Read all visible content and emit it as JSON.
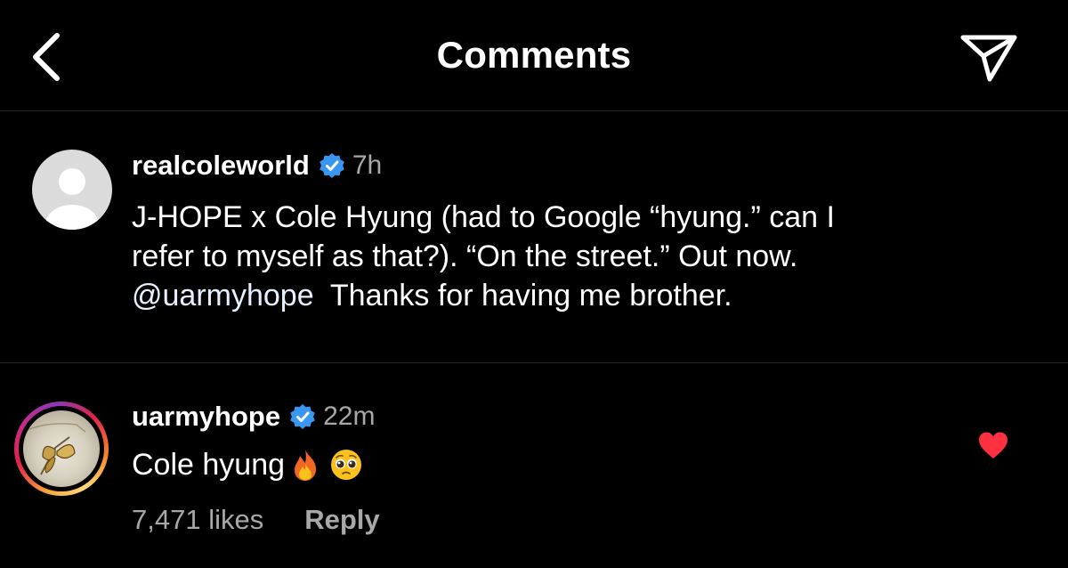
{
  "header": {
    "title": "Comments",
    "back_icon": "chevron-left-icon",
    "send_icon": "paper-plane-icon"
  },
  "caption": {
    "username": "realcoleworld",
    "verified": true,
    "time": "7h",
    "line1": "J-HOPE x Cole Hyung (had to Google “hyung.” can I",
    "line2": "refer to myself as that?). “On the street.” Out now.",
    "mention": "@uarmyhope",
    "line3_rest": "  Thanks for having me brother."
  },
  "comment": {
    "username": "uarmyhope",
    "verified": true,
    "time": "22m",
    "text": "Cole hyung",
    "emojis": [
      "fire-emoji",
      "pleading-face-emoji"
    ],
    "likes": "7,471 likes",
    "reply_label": "Reply",
    "liked": true
  },
  "colors": {
    "background": "#000000",
    "muted": "#a8a8a8",
    "verified": "#3897f0",
    "heart": "#ff3040",
    "divider": "#262626"
  }
}
